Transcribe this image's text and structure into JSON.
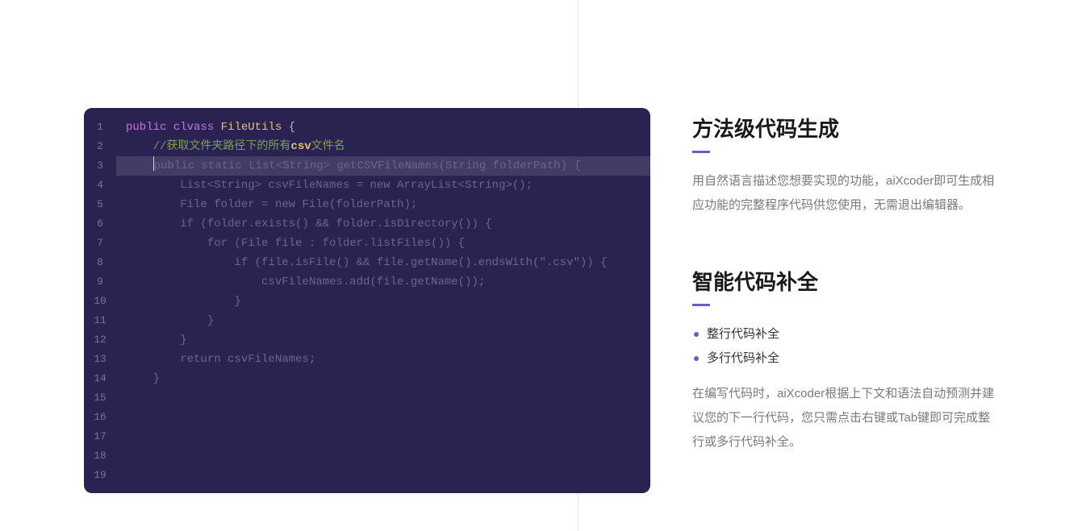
{
  "editor": {
    "line_numbers": [
      "1",
      "2",
      "3",
      "4",
      "5",
      "6",
      "7",
      "8",
      "9",
      "10",
      "11",
      "12",
      "13",
      "14",
      "15",
      "16",
      "17",
      "18",
      "19"
    ],
    "lines": {
      "l1_kw1": "public",
      "l1_kw2": "clvass",
      "l1_cls": "FileUtils",
      "l1_brace": " {",
      "l2_indent": "    ",
      "l2_cmt_pre": "//获取文件夹路径下的所有",
      "l2_cmt_hi": "csv",
      "l2_cmt_post": "文件名",
      "l3_indent": "    ",
      "l3_text": "public static List<String> getCSVFileNames(String folderPath) {",
      "l4": "        List<String> csvFileNames = new ArrayList<String>();",
      "l5": "        File folder = new File(folderPath);",
      "l6": "        if (folder.exists() && folder.isDirectory()) {",
      "l7": "            for (File file : folder.listFiles()) {",
      "l8": "                if (file.isFile() && file.getName().endsWith(\".csv\")) {",
      "l9": "                    csvFileNames.add(file.getName());",
      "l10": "                }",
      "l11": "            }",
      "l12": "        }",
      "l13": "        return csvFileNames;",
      "l14": "    }"
    }
  },
  "features": {
    "f1": {
      "title": "方法级代码生成",
      "desc": "用自然语言描述您想要实现的功能，aiXcoder即可生成相应功能的完整程序代码供您使用，无需退出编辑器。"
    },
    "f2": {
      "title": "智能代码补全",
      "bullets": [
        "整行代码补全",
        "多行代码补全"
      ],
      "desc": "在编写代码时，aiXcoder根据上下文和语法自动预测并建议您的下一行代码，您只需点击右键或Tab键即可完成整行或多行代码补全。"
    }
  }
}
